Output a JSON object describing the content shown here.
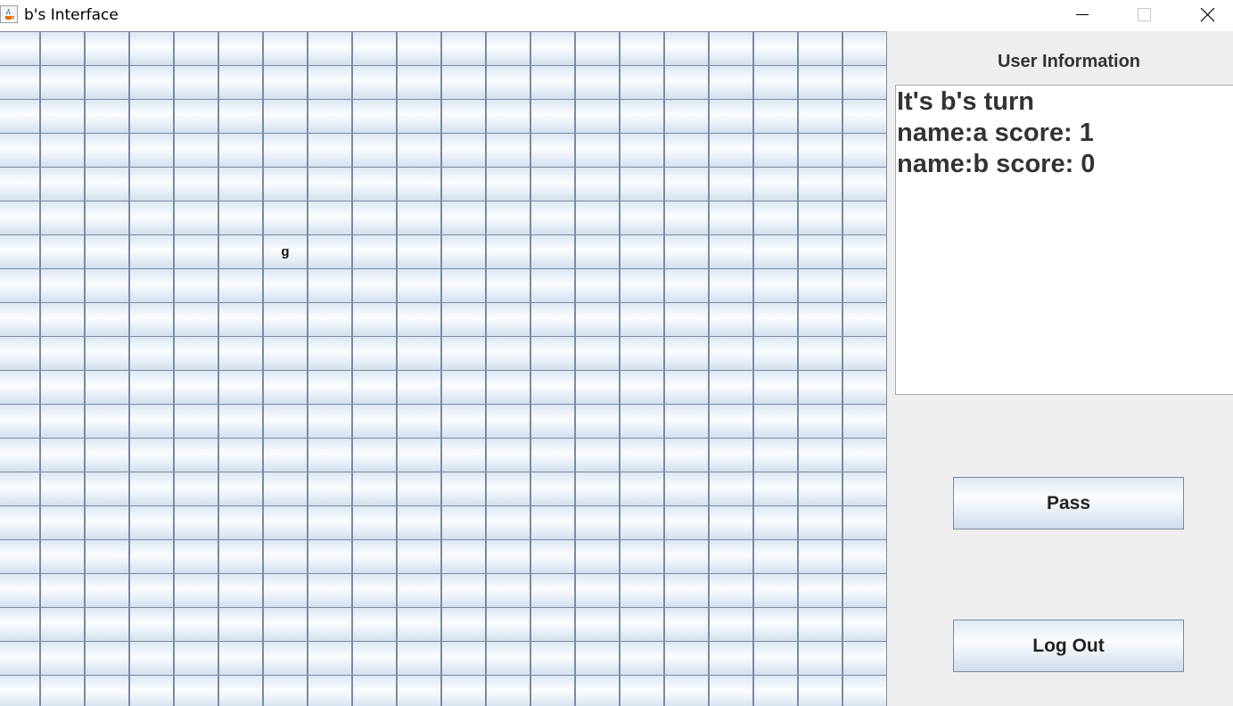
{
  "window": {
    "title": "b's Interface"
  },
  "board": {
    "columns": 20,
    "rows": 20,
    "pieces": [
      {
        "row": 6,
        "col": 6,
        "label": "g"
      }
    ]
  },
  "panel": {
    "title": "User Information",
    "lines": [
      "It's b's turn",
      "name:a score: 1",
      "name:b score: 0"
    ],
    "pass_label": "Pass",
    "logout_label": "Log Out"
  }
}
